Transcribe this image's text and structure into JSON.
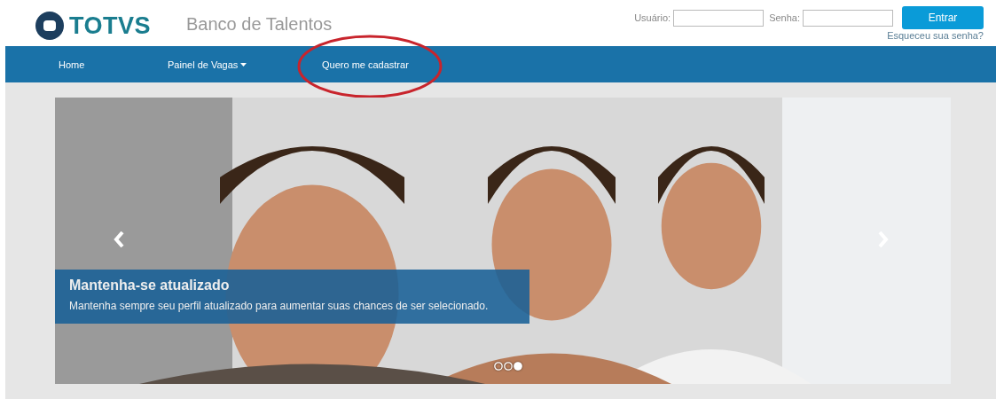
{
  "header": {
    "logo": "TOTVS",
    "title": "Banco de Talentos",
    "login": {
      "user_label": "Usuário:",
      "password_label": "Senha:",
      "submit": "Entrar",
      "forgot_link": "Esqueceu sua senha?"
    }
  },
  "nav": {
    "items": [
      {
        "label": "Home",
        "dropdown": false
      },
      {
        "label": "Painel de Vagas",
        "dropdown": true
      },
      {
        "label": "Quero me cadastrar",
        "dropdown": false
      }
    ],
    "annotation": {
      "kind": "ellipse"
    }
  },
  "carousel": {
    "caption": {
      "title": "Mantenha-se atualizado",
      "text": "Mantenha sempre seu perfil atualizado para aumentar suas chances de ser selecionado."
    },
    "indicators": [
      {
        "selected": false
      },
      {
        "selected": false
      },
      {
        "selected": true
      }
    ]
  }
}
